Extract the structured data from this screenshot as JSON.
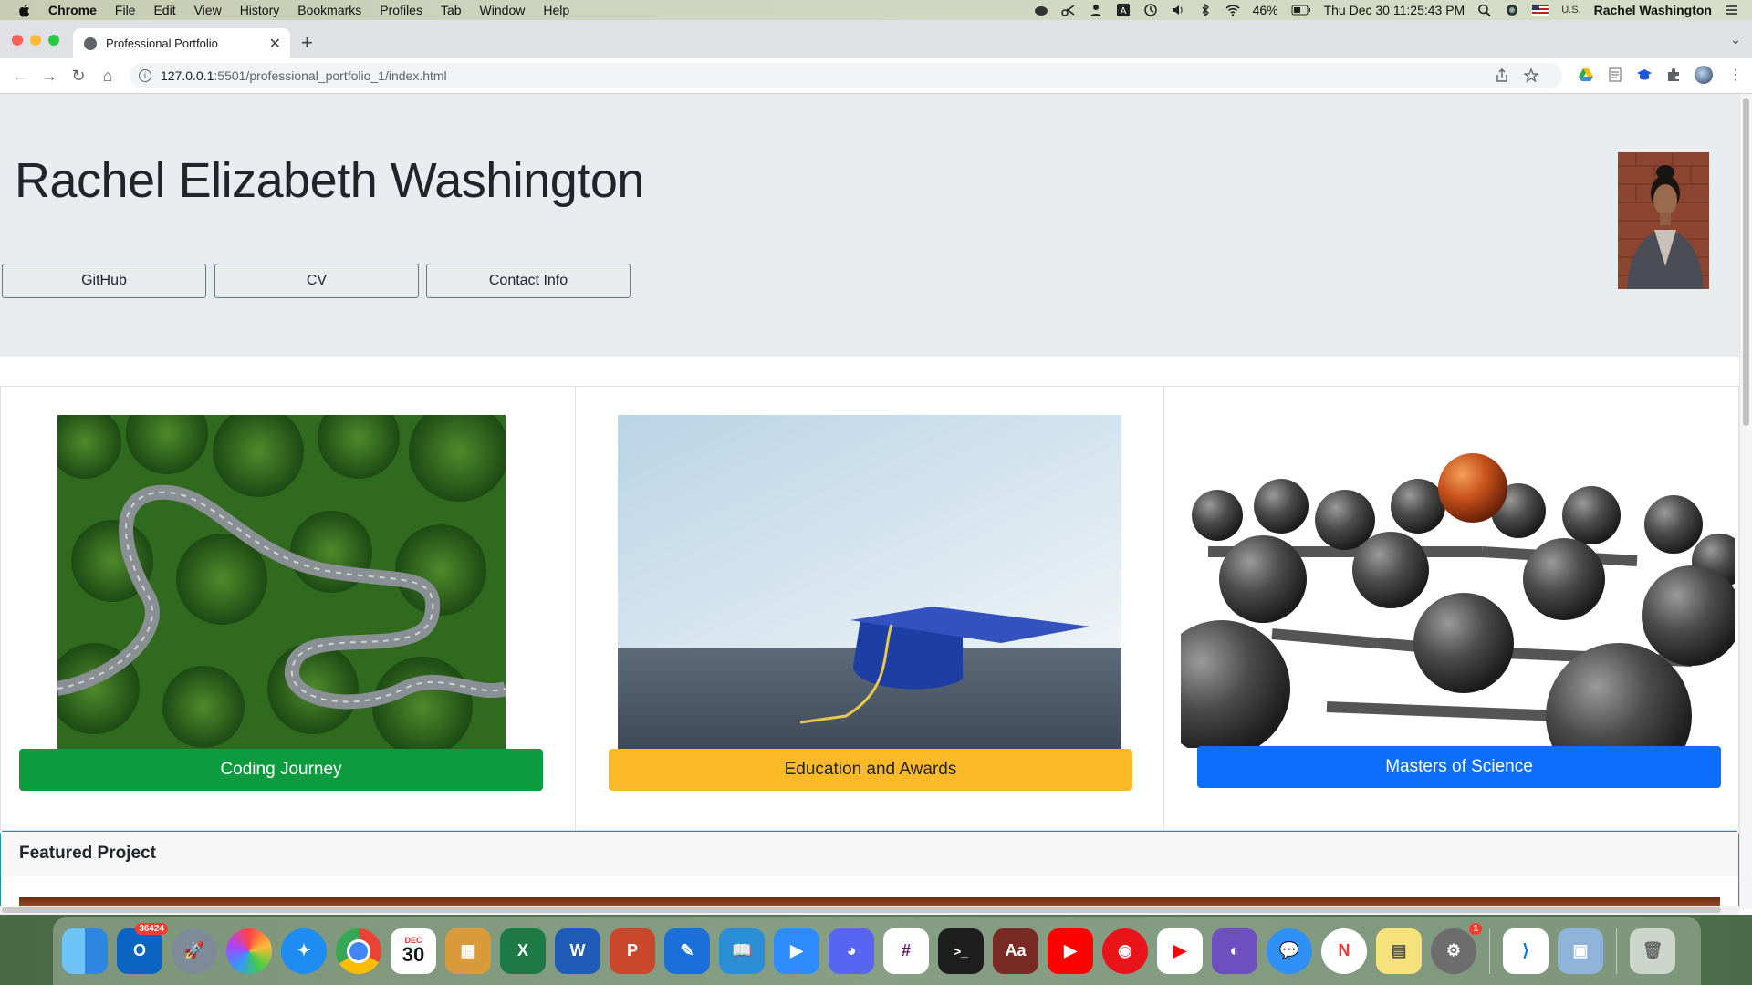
{
  "menubar": {
    "app": "Chrome",
    "items": [
      "File",
      "Edit",
      "View",
      "History",
      "Bookmarks",
      "Profiles",
      "Tab",
      "Window",
      "Help"
    ],
    "battery": "46%",
    "datetime": "Thu Dec 30  11:25:43 PM",
    "input_source": "U.S.",
    "user": "Rachel Washington"
  },
  "browser": {
    "tab_title": "Professional Portfolio",
    "url_host": "127.0.0.1",
    "url_rest": ":5501/professional_portfolio_1/index.html"
  },
  "page": {
    "name": "Rachel Elizabeth Washington",
    "buttons": [
      "GitHub",
      "CV",
      "Contact Info"
    ],
    "cards": [
      {
        "label": "Coding Journey",
        "color": "#0c9c3f"
      },
      {
        "label": "Education and Awards",
        "color": "#fcba28"
      },
      {
        "label": "Masters of Science",
        "color": "#0d6efd"
      }
    ],
    "featured_title": "Featured Project"
  },
  "dock": {
    "outlook_badge": "36424",
    "calendar_month": "DEC",
    "calendar_day": "30",
    "settings_badge": "1"
  }
}
